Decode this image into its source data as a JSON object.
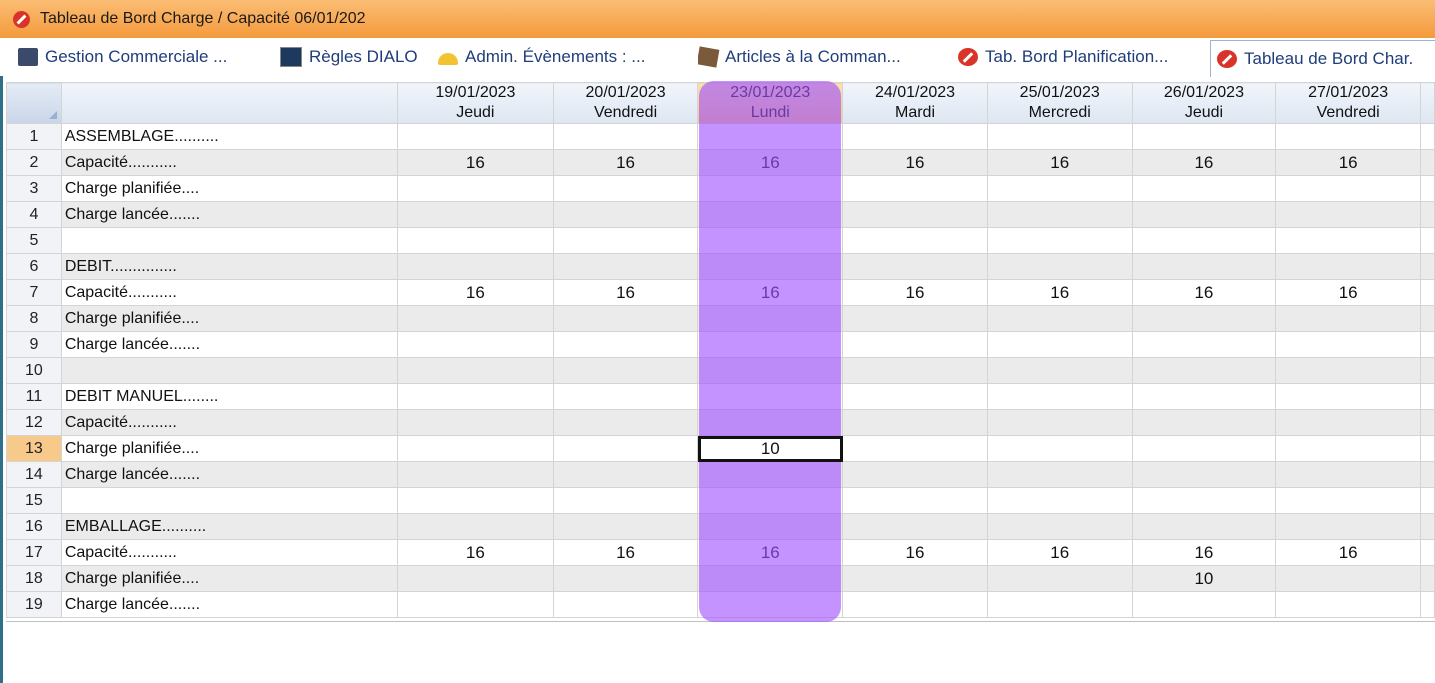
{
  "window": {
    "title": "Tableau de Bord Charge / Capacité 06/01/202"
  },
  "tabs": [
    {
      "label": "Gestion Commerciale ...",
      "icon": "database-icon"
    },
    {
      "label": "Règles DIALO",
      "icon": "keyboard-icon"
    },
    {
      "label": "Admin. Évènements : ...",
      "icon": "hard-hat-icon"
    },
    {
      "label": "Articles à la Comman...",
      "icon": "box-icon"
    },
    {
      "label": "Tab. Bord Planification...",
      "icon": "no-entry-icon"
    },
    {
      "label": "Tableau de Bord Char.",
      "icon": "no-entry-icon",
      "active": true
    }
  ],
  "grid": {
    "columns": [
      {
        "date": "19/01/2023",
        "day": "Jeudi"
      },
      {
        "date": "20/01/2023",
        "day": "Vendredi"
      },
      {
        "date": "23/01/2023",
        "day": "Lundi",
        "selected": true
      },
      {
        "date": "24/01/2023",
        "day": "Mardi"
      },
      {
        "date": "25/01/2023",
        "day": "Mercredi"
      },
      {
        "date": "26/01/2023",
        "day": "Jeudi"
      },
      {
        "date": "27/01/2023",
        "day": "Vendredi"
      }
    ],
    "rows": [
      {
        "num": "1",
        "label": "ASSEMBLAGE..........",
        "values": [
          "",
          "",
          "",
          "",
          "",
          "",
          ""
        ]
      },
      {
        "num": "2",
        "label": "Capacité...........",
        "values": [
          "16",
          "16",
          "16",
          "16",
          "16",
          "16",
          "16"
        ]
      },
      {
        "num": "3",
        "label": "Charge planifiée....",
        "values": [
          "",
          "",
          "",
          "",
          "",
          "",
          ""
        ]
      },
      {
        "num": "4",
        "label": "Charge lancée.......",
        "values": [
          "",
          "",
          "",
          "",
          "",
          "",
          ""
        ]
      },
      {
        "num": "5",
        "label": "",
        "values": [
          "",
          "",
          "",
          "",
          "",
          "",
          ""
        ]
      },
      {
        "num": "6",
        "label": "DEBIT...............",
        "values": [
          "",
          "",
          "",
          "",
          "",
          "",
          ""
        ]
      },
      {
        "num": "7",
        "label": "Capacité...........",
        "values": [
          "16",
          "16",
          "16",
          "16",
          "16",
          "16",
          "16"
        ]
      },
      {
        "num": "8",
        "label": "Charge planifiée....",
        "values": [
          "",
          "",
          "",
          "",
          "",
          "",
          ""
        ]
      },
      {
        "num": "9",
        "label": "Charge lancée.......",
        "values": [
          "",
          "",
          "",
          "",
          "",
          "",
          ""
        ]
      },
      {
        "num": "10",
        "label": "",
        "values": [
          "",
          "",
          "",
          "",
          "",
          "",
          ""
        ]
      },
      {
        "num": "11",
        "label": "DEBIT MANUEL........",
        "values": [
          "",
          "",
          "",
          "",
          "",
          "",
          ""
        ]
      },
      {
        "num": "12",
        "label": "Capacité...........",
        "values": [
          "",
          "",
          "",
          "",
          "",
          "",
          ""
        ]
      },
      {
        "num": "13",
        "label": "Charge planifiée....",
        "values": [
          "",
          "",
          "10",
          "",
          "",
          "",
          ""
        ],
        "current": true
      },
      {
        "num": "14",
        "label": "Charge lancée.......",
        "values": [
          "",
          "",
          "",
          "",
          "",
          "",
          ""
        ]
      },
      {
        "num": "15",
        "label": "",
        "values": [
          "",
          "",
          "",
          "",
          "",
          "",
          ""
        ]
      },
      {
        "num": "16",
        "label": "EMBALLAGE..........",
        "values": [
          "",
          "",
          "",
          "",
          "",
          "",
          ""
        ]
      },
      {
        "num": "17",
        "label": "Capacité...........",
        "values": [
          "16",
          "16",
          "16",
          "16",
          "16",
          "16",
          "16"
        ]
      },
      {
        "num": "18",
        "label": "Charge planifiée....",
        "values": [
          "",
          "",
          "",
          "",
          "",
          "10",
          ""
        ]
      },
      {
        "num": "19",
        "label": "Charge lancée.......",
        "values": [
          "",
          "",
          "",
          "",
          "",
          "",
          ""
        ]
      }
    ]
  },
  "colors": {
    "titlebar": "#f49a3c",
    "highlight": "#a050ff",
    "selected_header": "#f6c982"
  }
}
